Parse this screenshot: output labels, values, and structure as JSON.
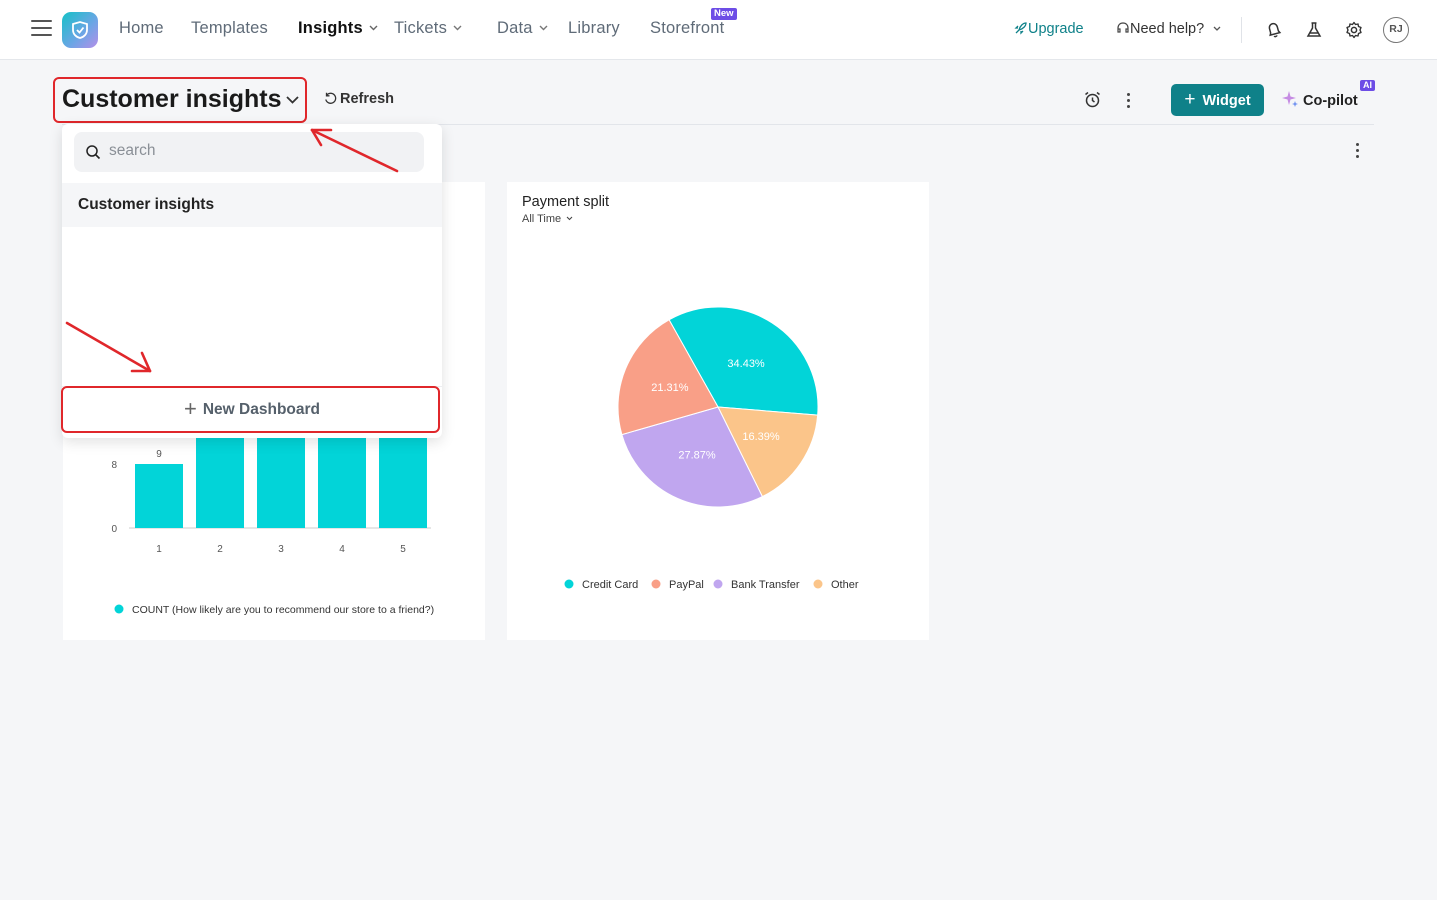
{
  "nav": {
    "items": [
      "Home",
      "Templates",
      "Insights",
      "Tickets",
      "Data",
      "Library",
      "Storefront"
    ],
    "new_badge": "New",
    "upgrade": "Upgrade",
    "need_help": "Need help?",
    "avatar": "RJ"
  },
  "header": {
    "title": "Customer insights",
    "refresh": "Refresh",
    "widget": "Widget",
    "copilot": "Co-pilot",
    "ai_badge": "AI"
  },
  "dropdown": {
    "search_placeholder": "search",
    "items": [
      "Customer insights"
    ],
    "new_dashboard": "New Dashboard"
  },
  "cards": [
    {
      "chart_data": {
        "type": "bar",
        "categories": [
          "1",
          "2",
          "3",
          "4",
          "5"
        ],
        "values": [
          8,
          12,
          12,
          12,
          12
        ],
        "data_labels": [
          "9"
        ],
        "y_ticks": [
          "8",
          "0"
        ],
        "ylim": [
          0,
          14
        ],
        "legend": [
          "COUNT (How likely are you to recommend our store to a friend?)"
        ],
        "colors": [
          "#02d4d8"
        ]
      }
    },
    {
      "title": "Payment split",
      "range": "All Time",
      "chart_data": {
        "type": "pie",
        "categories": [
          "Credit Card",
          "PayPal",
          "Bank Transfer",
          "Other"
        ],
        "values": [
          34.43,
          21.31,
          27.87,
          16.39
        ],
        "labels": [
          "34.43%",
          "21.31%",
          "27.87%",
          "16.39%"
        ],
        "colors": [
          "#02d4d8",
          "#f99f87",
          "#c0a6ef",
          "#fbc58a"
        ],
        "legend_position": "bottom"
      }
    }
  ]
}
